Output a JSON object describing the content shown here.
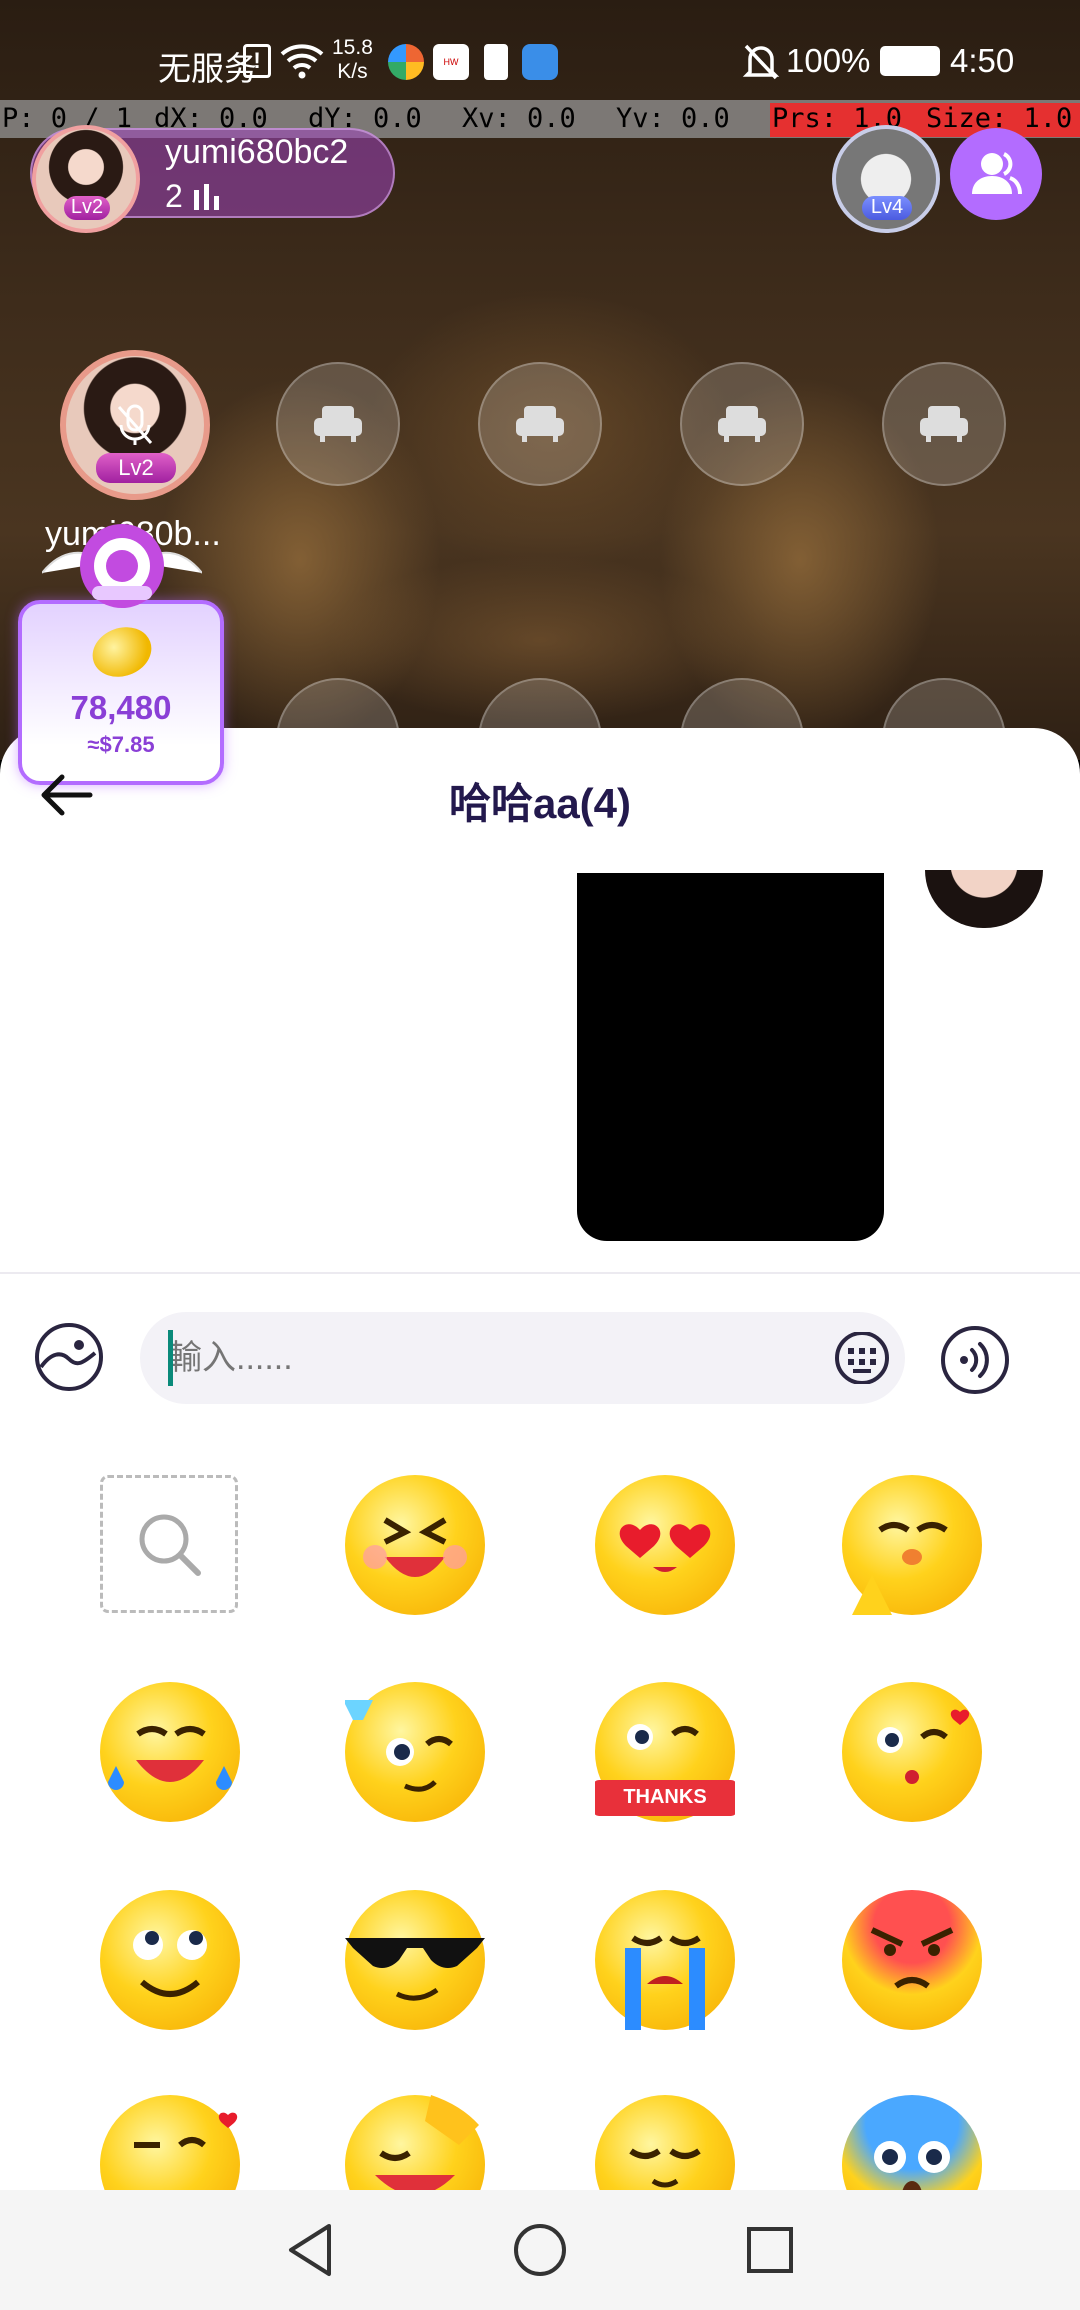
{
  "status_bar": {
    "carrier": "无服务",
    "speed_value": "15.8",
    "speed_unit": "K/s",
    "battery": "100%",
    "time": "4:50"
  },
  "debug_overlay": {
    "p": "P: 0 / 1",
    "dx": "dX: 0.0",
    "dy": "dY: 0.0",
    "xv": "Xv: 0.0",
    "yv": "Yv: 0.0",
    "prs": "Prs: 1.0",
    "size": "Size: 1.0"
  },
  "room": {
    "host": {
      "name": "yumi680bc2",
      "count": "2",
      "level": "Lv2"
    },
    "top_right_level": "Lv4",
    "seat_user": {
      "name": "yumi680b...",
      "level": "Lv2"
    },
    "coin": {
      "amount": "78,480",
      "usd": "≈$7.85"
    }
  },
  "chat": {
    "title": "哈哈aa(4)",
    "input_placeholder": "輸入......"
  },
  "emoji_panel": {
    "items": [
      "search",
      "laughing-squint",
      "heart-eyes",
      "pray",
      "tears-of-joy",
      "cheers-wink",
      "thanks",
      "kiss",
      "rolling-eyes",
      "sunglasses",
      "crying",
      "angry",
      "shy-heart",
      "facepalm",
      "relieved",
      "shocked"
    ],
    "thanks_label": "THANKS"
  },
  "colors": {
    "accent": "#b36cff",
    "title": "#23194d",
    "debug_red": "#e53030"
  }
}
